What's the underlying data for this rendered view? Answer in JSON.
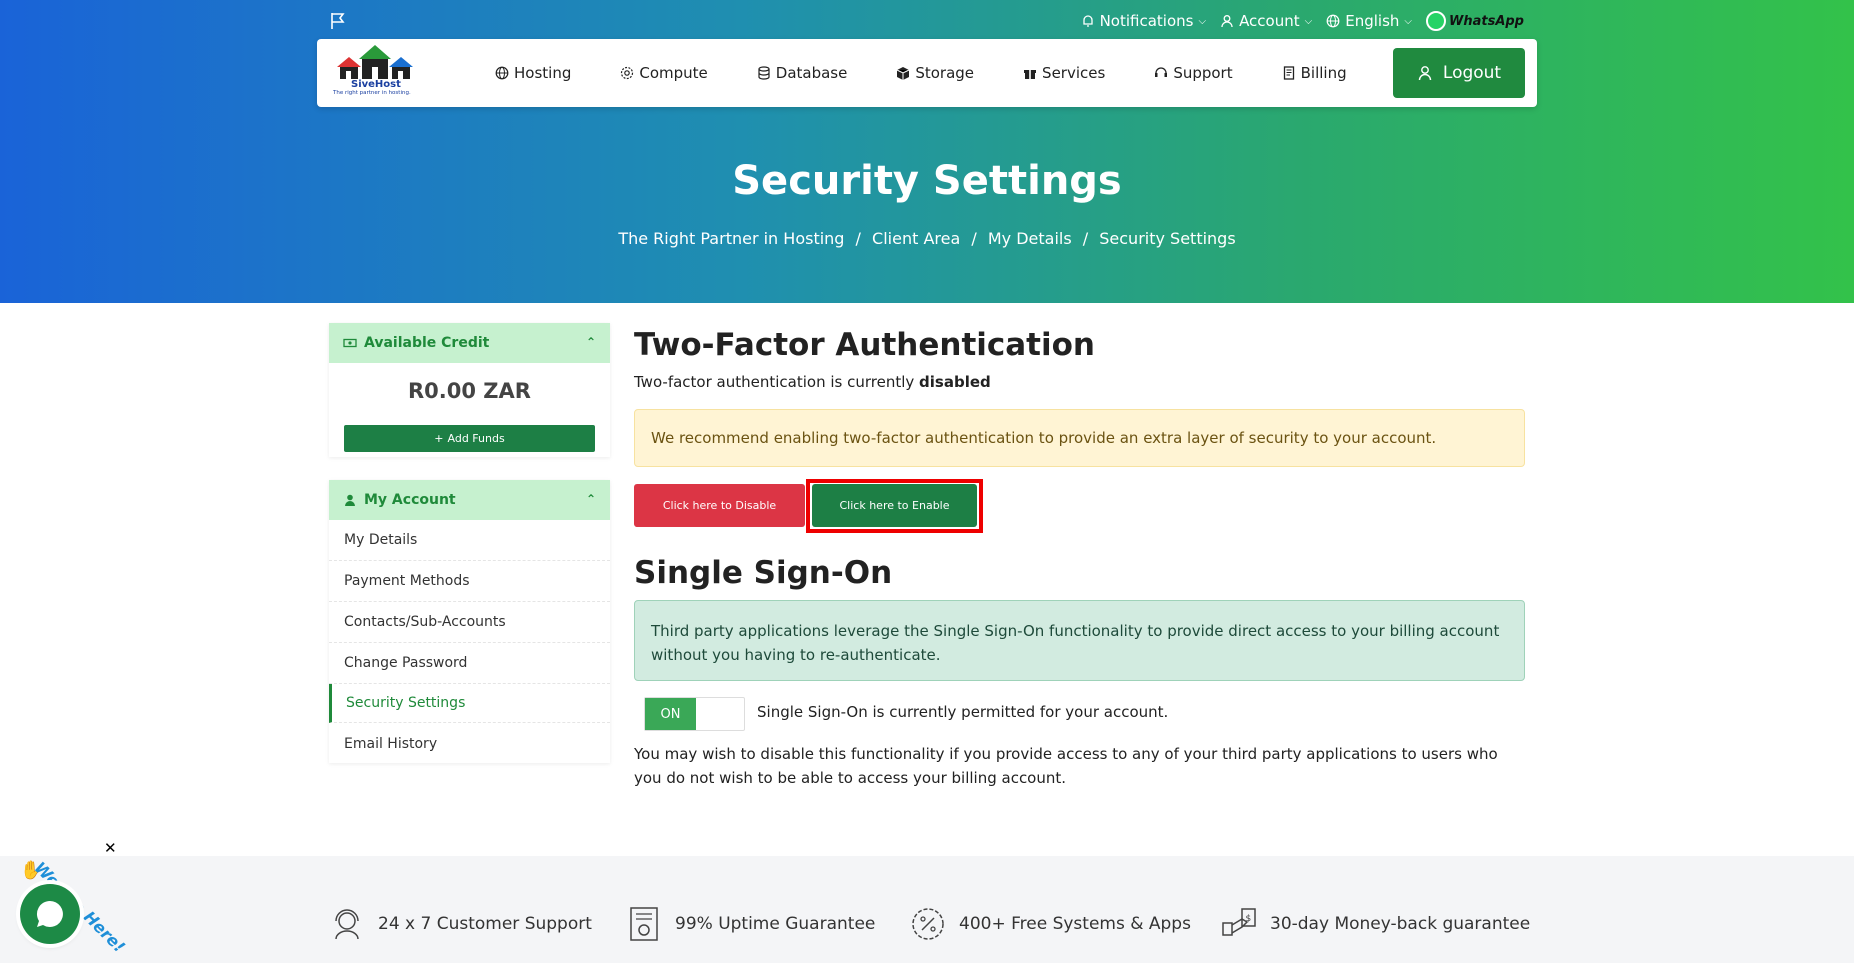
{
  "topbar": {
    "notifications": "Notifications",
    "account": "Account",
    "language": "English",
    "whatsapp": "WhatsApp"
  },
  "logo": {
    "name": "SiveHost",
    "tagline": "The right partner in hosting."
  },
  "nav": {
    "items": [
      {
        "label": "Hosting",
        "icon": "globe-icon"
      },
      {
        "label": "Compute",
        "icon": "gear-icon"
      },
      {
        "label": "Database",
        "icon": "database-icon"
      },
      {
        "label": "Storage",
        "icon": "box-icon"
      },
      {
        "label": "Services",
        "icon": "gift-icon"
      },
      {
        "label": "Support",
        "icon": "headset-icon"
      },
      {
        "label": "Billing",
        "icon": "document-icon"
      }
    ],
    "logout": "Logout"
  },
  "hero": {
    "title": "Security Settings",
    "breadcrumb": [
      "The Right Partner in Hosting",
      "Client Area",
      "My Details",
      "Security Settings"
    ]
  },
  "sidebar": {
    "credit": {
      "title": "Available Credit",
      "amount": "R0.00 ZAR",
      "add_funds": "Add Funds"
    },
    "account": {
      "title": "My Account",
      "items": [
        "My Details",
        "Payment Methods",
        "Contacts/Sub-Accounts",
        "Change Password",
        "Security Settings",
        "Email History"
      ],
      "active": "Security Settings"
    }
  },
  "twofa": {
    "heading": "Two-Factor Authentication",
    "status_prefix": "Two-factor authentication is currently",
    "status_value": "disabled",
    "recommendation": "We recommend enabling two-factor authentication to provide an extra layer of security to your account.",
    "disable_button": "Click here to Disable",
    "enable_button": "Click here to Enable"
  },
  "sso": {
    "heading": "Single Sign-On",
    "info": "Third party applications leverage the Single Sign-On functionality to provide direct access to your billing account without you having to re-authenticate.",
    "toggle": "ON",
    "status": "Single Sign-On is currently permitted for your account.",
    "note": "You may wish to disable this functionality if you provide access to any of your third party applications to users who you do not wish to be able to access your billing account."
  },
  "features": [
    {
      "label": "24 x 7 Customer Support",
      "icon": "support-agent-icon"
    },
    {
      "label": "99% Uptime Guarantee",
      "icon": "certificate-icon"
    },
    {
      "label": "400+ Free Systems & Apps",
      "icon": "discount-badge-icon"
    },
    {
      "label": "30-day Money-back guarantee",
      "icon": "money-back-icon"
    }
  ],
  "chat": {
    "label": "We Are Here!"
  },
  "colors": {
    "primary_green": "#1d7f45",
    "danger_red": "#dc3545",
    "highlight": "#e00000"
  }
}
